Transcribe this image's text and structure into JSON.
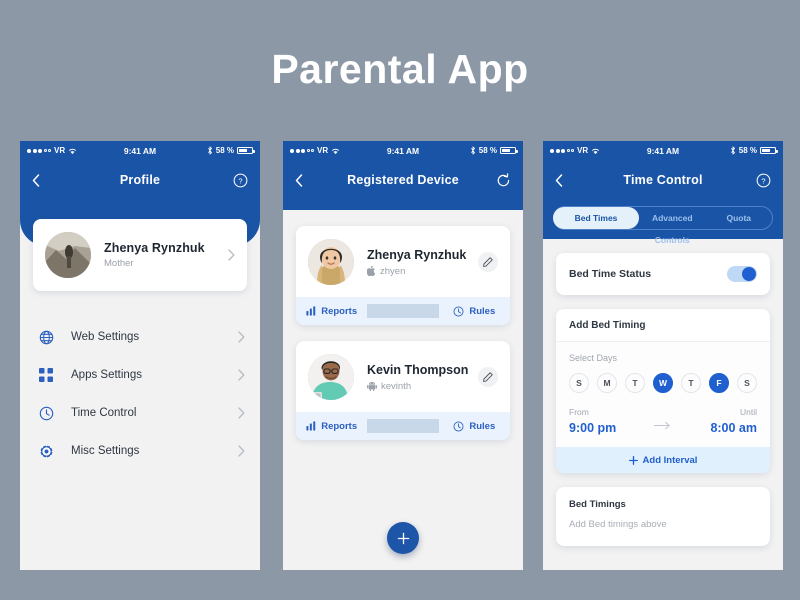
{
  "page": {
    "title": "Parental App",
    "background_color": "#8d98a6"
  },
  "theme": {
    "brand_blue": "#1a54a6",
    "accent_blue": "#1f5fd0",
    "light_blue": "#e0f0fc",
    "card_white": "#ffffff"
  },
  "statusbar": {
    "carrier": "VR",
    "time": "9:41 AM",
    "battery_text": "58 %",
    "signal_icon": "signal-dots-icon",
    "wifi_icon": "wifi-icon",
    "bluetooth_icon": "bluetooth-icon",
    "battery_icon": "battery-icon"
  },
  "screen1": {
    "nav": {
      "back_icon": "back-chevron-icon",
      "title": "Profile",
      "right_icon": "help-circle-icon"
    },
    "profile": {
      "name": "Zhenya Rynzhuk",
      "role": "Mother",
      "avatar_icon": "avatar-photo",
      "chevron_icon": "chevron-right-icon"
    },
    "menu": [
      {
        "label": "Web Settings",
        "icon": "globe-icon"
      },
      {
        "label": "Apps Settings",
        "icon": "grid-icon"
      },
      {
        "label": "Time Control",
        "icon": "clock-icon"
      },
      {
        "label": "Misc Settings",
        "icon": "gear-icon"
      }
    ]
  },
  "screen2": {
    "nav": {
      "back_icon": "back-chevron-icon",
      "title": "Registered Device",
      "right_icon": "refresh-icon"
    },
    "devices": [
      {
        "name": "Zhenya Rynzhuk",
        "handle": "zhyen",
        "platform_icon": "apple-icon",
        "edit_icon": "pencil-icon",
        "reports_label": "Reports",
        "reports_icon": "bar-chart-icon",
        "rules_label": "Rules",
        "rules_icon": "clock-icon"
      },
      {
        "name": "Kevin Thompson",
        "handle": "kevinth",
        "platform_icon": "android-icon",
        "edit_icon": "pencil-icon",
        "reports_label": "Reports",
        "reports_icon": "bar-chart-icon",
        "rules_label": "Rules",
        "rules_icon": "clock-icon"
      }
    ],
    "fab": {
      "label": "+",
      "icon": "plus-icon"
    }
  },
  "screen3": {
    "nav": {
      "back_icon": "back-chevron-icon",
      "title": "Time Control",
      "right_icon": "help-circle-icon"
    },
    "tabs": [
      {
        "label": "Bed Times",
        "active": true
      },
      {
        "label": "Advanced Controls",
        "active": false
      },
      {
        "label": "Quota",
        "active": false
      }
    ],
    "bed_time_status": {
      "label": "Bed Time Status",
      "enabled": true
    },
    "add_bed_timing": {
      "title": "Add Bed Timing",
      "select_days_label": "Select Days",
      "days": [
        {
          "letter": "S",
          "selected": false
        },
        {
          "letter": "M",
          "selected": false
        },
        {
          "letter": "T",
          "selected": false
        },
        {
          "letter": "W",
          "selected": true
        },
        {
          "letter": "T",
          "selected": false
        },
        {
          "letter": "F",
          "selected": true
        },
        {
          "letter": "S",
          "selected": false
        }
      ],
      "from_label": "From",
      "from_value": "9:00 pm",
      "until_label": "Until",
      "until_value": "8:00 am",
      "arrow_icon": "arrow-right-icon",
      "add_interval_label": "Add Interval",
      "add_interval_icon": "plus-icon"
    },
    "bed_timings": {
      "title": "Bed Timings",
      "empty_text": "Add Bed timings above"
    }
  }
}
